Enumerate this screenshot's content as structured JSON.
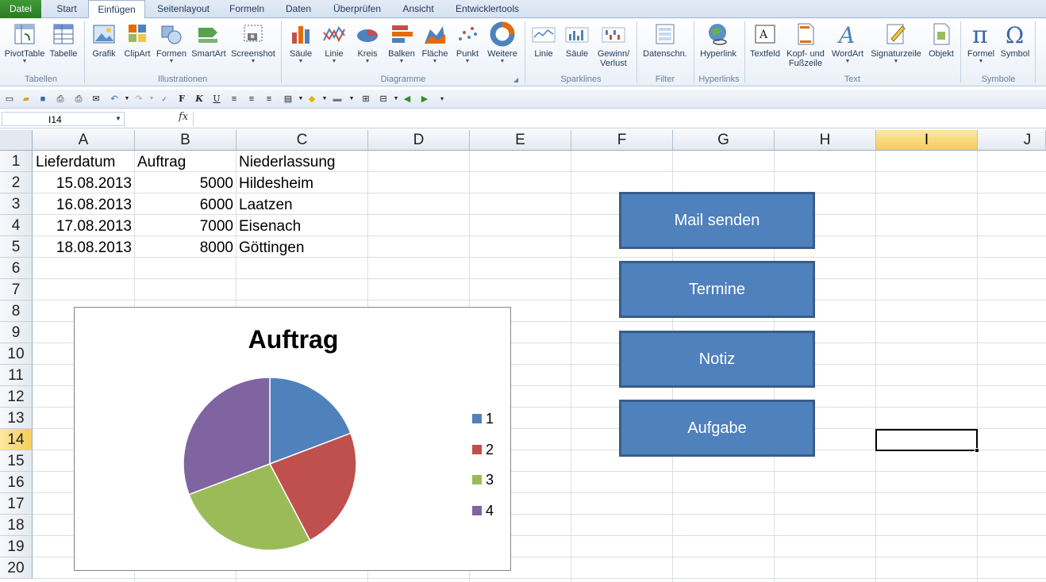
{
  "tabs": {
    "file": "Datei",
    "items": [
      "Start",
      "Einfügen",
      "Seitenlayout",
      "Formeln",
      "Daten",
      "Überprüfen",
      "Ansicht",
      "Entwicklertools"
    ],
    "active": "Einfügen"
  },
  "ribbon": {
    "buttons": {
      "pivottable": "PivotTable",
      "tabelle": "Tabelle",
      "grafik": "Grafik",
      "clipart": "ClipArt",
      "formen": "Formen",
      "smartart": "SmartArt",
      "screenshot": "Screenshot",
      "saeule": "Säule",
      "linie": "Linie",
      "kreis": "Kreis",
      "balken": "Balken",
      "flaeche": "Fläche",
      "punkt": "Punkt",
      "weitere": "Weitere",
      "spark_linie": "Linie",
      "spark_saeule": "Säule",
      "spark_gewinn_1": "Gewinn/",
      "spark_gewinn_2": "Verlust",
      "datenschnitt": "Datenschn.",
      "hyperlink": "Hyperlink",
      "textfeld": "Textfeld",
      "kopf_1": "Kopf- und",
      "kopf_2": "Fußzeile",
      "wordart": "WordArt",
      "signatur": "Signaturzeile",
      "objekt": "Objekt",
      "formel": "Formel",
      "symbol": "Symbol"
    },
    "groups": {
      "tabellen": "Tabellen",
      "illustrationen": "Illustrationen",
      "diagramme": "Diagramme",
      "sparklines": "Sparklines",
      "filter": "Filter",
      "hyperlinks": "Hyperlinks",
      "text": "Text",
      "symbole": "Symbole"
    }
  },
  "formula_bar": {
    "name_box": "I14",
    "fx": "fx",
    "value": ""
  },
  "grid": {
    "columns": [
      "A",
      "B",
      "C",
      "D",
      "E",
      "F",
      "G",
      "H",
      "I",
      "J"
    ],
    "rows": [
      "1",
      "2",
      "3",
      "4",
      "5",
      "6",
      "7",
      "8",
      "9",
      "10",
      "11",
      "12",
      "13",
      "14",
      "15",
      "16",
      "17",
      "18",
      "19",
      "20"
    ],
    "selected_cell": "I14",
    "headers": {
      "a": "Lieferdatum",
      "b": "Auftrag",
      "c": "Niederlassung"
    },
    "data": [
      {
        "a": "15.08.2013",
        "b": "5000",
        "c": "Hildesheim"
      },
      {
        "a": "16.08.2013",
        "b": "6000",
        "c": "Laatzen"
      },
      {
        "a": "17.08.2013",
        "b": "7000",
        "c": "Eisenach"
      },
      {
        "a": "18.08.2013",
        "b": "8000",
        "c": "Göttingen"
      }
    ]
  },
  "macro_buttons": [
    "Mail senden",
    "Termine",
    "Notiz",
    "Aufgabe"
  ],
  "chart_data": {
    "type": "pie",
    "title": "Auftrag",
    "categories": [
      "1",
      "2",
      "3",
      "4"
    ],
    "values": [
      5000,
      6000,
      7000,
      8000
    ],
    "colors": [
      "#4f81bd",
      "#c0504d",
      "#9bbb59",
      "#8064a2"
    ],
    "legend": "right"
  },
  "colors": {
    "accent_button": "#4f81bd",
    "file_tab": "#2a7a22",
    "selection_header": "#f5cd5a"
  }
}
